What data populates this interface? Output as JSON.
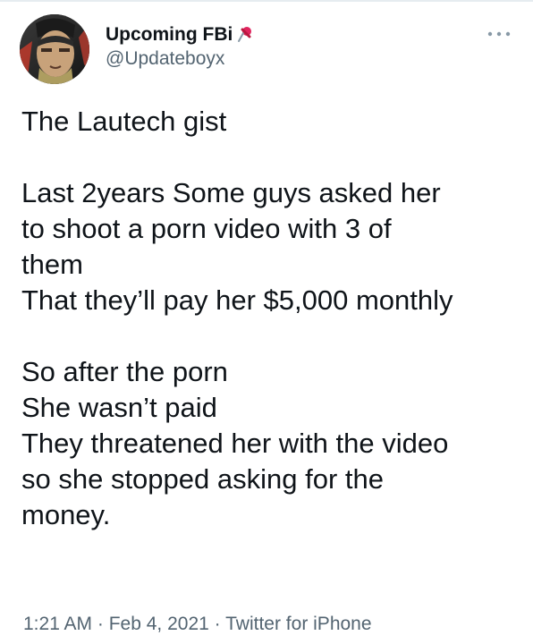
{
  "user": {
    "display_name": "Upcoming FBi",
    "handle": "@Updateboyx"
  },
  "tweet": {
    "text": "The Lautech gist\n\nLast 2years Some guys asked her\nto shoot a porn video with 3 of\nthem\nThat they’ll pay her $5,000 monthly\n\nSo after the porn\nShe wasn’t paid\nThey threatened her with the video\nso she stopped asking for the\nmoney.",
    "time": "1:21 AM",
    "separator": " · ",
    "date": "Feb 4, 2021",
    "source": "Twitter for iPhone"
  },
  "icons": {
    "name_badge": "pushpin-icon",
    "menu": "more-horizontal-icon"
  },
  "colors": {
    "text": "#0f1419",
    "secondary": "#536471",
    "pin": "#e0245e"
  }
}
